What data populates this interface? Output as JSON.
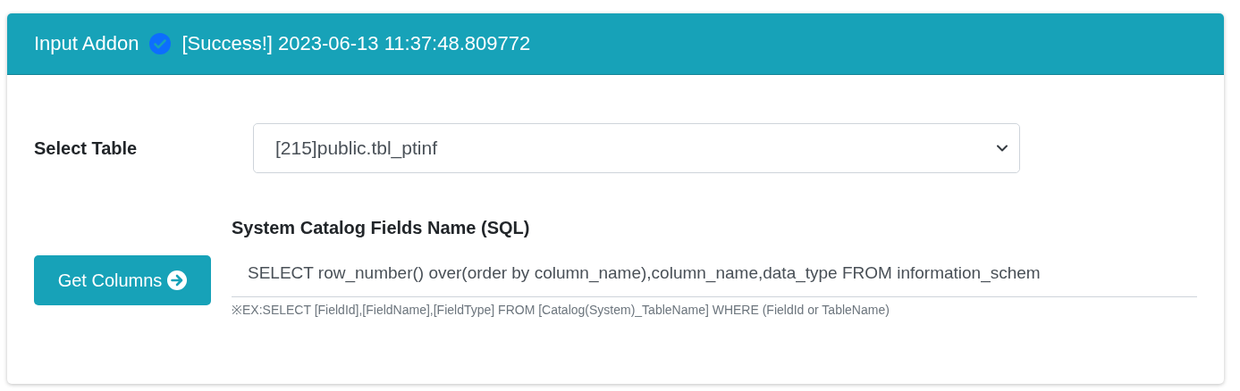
{
  "header": {
    "title": "Input Addon",
    "status": "[Success!] 2023-06-13 11:37:48.809772"
  },
  "select_table": {
    "label": "Select Table",
    "value": "[215]public.tbl_ptinf"
  },
  "get_columns_button": {
    "label": "Get Columns"
  },
  "sql_field": {
    "label": "System Catalog Fields Name (SQL)",
    "value": "SELECT row_number() over(order by column_name),column_name,data_type FROM information_schem",
    "hint": "※EX:SELECT [FieldId],[FieldName],[FieldType] FROM [Catalog(System)_TableName] WHERE (FieldId or TableName)"
  }
}
